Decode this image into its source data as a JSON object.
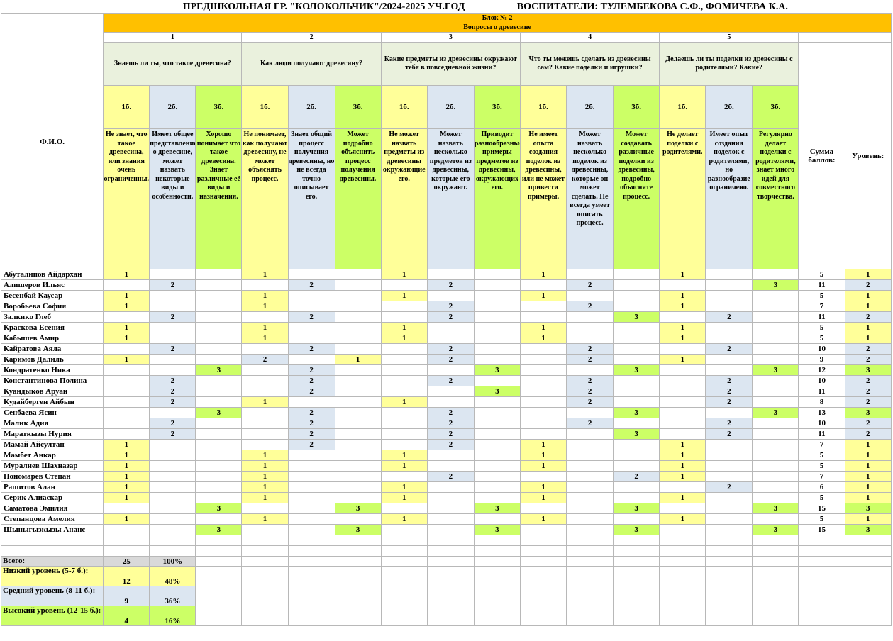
{
  "title_left": "ПРЕДШКОЛЬНАЯ ГР. \"КОЛОКОЛЬЧИК\"/2024-2025 УЧ.ГОД",
  "title_right": "ВОСПИТАТЕЛИ: ТУЛЕМБЕКОВА С.Ф., ФОМИЧЕВА К.А.",
  "block": "Блок № 2",
  "subject": "Вопросы о древесине",
  "fio_header": "Ф.И.О.",
  "sum_header": "Сумма баллов:",
  "level_header": "Уровень:",
  "questions": [
    {
      "num": "1",
      "text": "Знаешь ли ты, что такое древесина?",
      "points": [
        "1б.",
        "2б.",
        "3б."
      ],
      "desc": [
        "Не знает, что такое древесина, или знания очень ограниченны.",
        "Имеет общее представление о древесине, может назвать некоторые виды и особенности.",
        "Хорошо понимает что такое древесина. Знает различные её виды и назначения."
      ]
    },
    {
      "num": "2",
      "text": "Как люди получают древесину?",
      "points": [
        "1б.",
        "2б.",
        "3б."
      ],
      "desc": [
        "Не понимает, как получают древесину, не может объяснять процесс.",
        "Знает общий процесс получения древесины, но не всегда точно описывает его.",
        "Может подробно объяснить процесс получения древесины."
      ]
    },
    {
      "num": "3",
      "text": "Какие предметы из древесины окружают тебя в повседневной жизни?",
      "points": [
        "1б.",
        "2б.",
        "3б."
      ],
      "desc": [
        "Не может назвать предметы из древесины окружающие его.",
        "Может назвать несколько предметов из древесины, которые его окружают.",
        "Приводит разнообразные примеры предметов из древесины, окружающих его."
      ]
    },
    {
      "num": "4",
      "text": "Что ты можешь сделать из древесины сам? Какие поделки и игрушки?",
      "points": [
        "1б.",
        "2б.",
        "3б."
      ],
      "desc": [
        "Не имеет опыта создания поделок из древесины, или не может привести примеры.",
        "Может назвать несколько поделок из древесины, которые он может сделать. Не всегда умеет описать процесс.",
        "Может создавать различные поделки из древесины, подробно объясняте процесс."
      ]
    },
    {
      "num": "5",
      "text": "Делаешь ли ты поделки из древесины с родителями? Какие?",
      "points": [
        "1б.",
        "2б.",
        "3б."
      ],
      "desc": [
        "Не делает поделки с родителями.",
        "Имеет опыт создания поделок с родителями, но разнообразие ограничено.",
        "Регулярно делает поделки с родителями, знает много идей для совместного творчества."
      ]
    }
  ],
  "children": [
    {
      "name": "Абуталипов Айдархан",
      "s": [
        "1",
        "",
        "",
        "1",
        "",
        "",
        "1",
        "",
        "",
        "1",
        "",
        "",
        "1",
        "",
        ""
      ],
      "sum": "5",
      "level": "1"
    },
    {
      "name": "Алишеров Ильяс",
      "s": [
        "",
        "2",
        "",
        "",
        "2",
        "",
        "",
        "2",
        "",
        "",
        "2",
        "",
        "",
        "",
        "3"
      ],
      "sum": "11",
      "level": "2"
    },
    {
      "name": "Бесенбай Каусар",
      "s": [
        "1",
        "",
        "",
        "1",
        "",
        "",
        "1",
        "",
        "",
        "1",
        "",
        "",
        "1",
        "",
        ""
      ],
      "sum": "5",
      "level": "1"
    },
    {
      "name": "Воробьева София",
      "s": [
        "1",
        "",
        "",
        "1",
        "",
        "",
        "",
        "2",
        "",
        "",
        "2",
        "",
        "1",
        "",
        ""
      ],
      "sum": "7",
      "level": "1"
    },
    {
      "name": "Залкико Глеб",
      "s": [
        "",
        "2",
        "",
        "",
        "2",
        "",
        "",
        "2",
        "",
        "",
        "",
        "3",
        "",
        "2",
        ""
      ],
      "sum": "11",
      "level": "2"
    },
    {
      "name": "Краскова Есения",
      "s": [
        "1",
        "",
        "",
        "1",
        "",
        "",
        "1",
        "",
        "",
        "1",
        "",
        "",
        "1",
        "",
        ""
      ],
      "sum": "5",
      "level": "1"
    },
    {
      "name": "Кабышев Амир",
      "s": [
        "1",
        "",
        "",
        "1",
        "",
        "",
        "1",
        "",
        "",
        "1",
        "",
        "",
        "1",
        "",
        ""
      ],
      "sum": "5",
      "level": "1"
    },
    {
      "name": "Кайратова Аяла",
      "s": [
        "",
        "2",
        "",
        "",
        "2",
        "",
        "",
        "2",
        "",
        "",
        "2",
        "",
        "",
        "2",
        ""
      ],
      "sum": "10",
      "level": "2"
    },
    {
      "name": "Каримов Далиль",
      "s": [
        "1",
        "",
        "",
        "2",
        "",
        "1",
        "",
        "2",
        "",
        "",
        "2",
        "",
        "1",
        "",
        ""
      ],
      "sum": "9",
      "level": "2"
    },
    {
      "name": "Кондратенко Ника",
      "s": [
        "",
        "",
        "3",
        "",
        "2",
        "",
        "",
        "",
        "3",
        "",
        "",
        "3",
        "",
        "",
        "3"
      ],
      "sum": "12",
      "level": "3"
    },
    {
      "name": "Константинова Полина",
      "s": [
        "",
        "2",
        "",
        "",
        "2",
        "",
        "",
        "2",
        "",
        "",
        "2",
        "",
        "",
        "2",
        ""
      ],
      "sum": "10",
      "level": "2"
    },
    {
      "name": "Куандыков Аруан",
      "s": [
        "",
        "2",
        "",
        "",
        "2",
        "",
        "",
        "",
        "3",
        "",
        "2",
        "",
        "",
        "2",
        ""
      ],
      "sum": "11",
      "level": "2"
    },
    {
      "name": "Кудайберген Айбын",
      "s": [
        "",
        "2",
        "",
        "1",
        "",
        "",
        "1",
        "",
        "",
        "",
        "2",
        "",
        "",
        "2",
        ""
      ],
      "sum": "8",
      "level": "2"
    },
    {
      "name": "Сенбаева Ясин",
      "s": [
        "",
        "",
        "3",
        "",
        "2",
        "",
        "",
        "2",
        "",
        "",
        "",
        "3",
        "",
        "",
        "3"
      ],
      "sum": "13",
      "level": "3"
    },
    {
      "name": "Малик Адия",
      "s": [
        "",
        "2",
        "",
        "",
        "2",
        "",
        "",
        "2",
        "",
        "",
        "2",
        "",
        "",
        "2",
        ""
      ],
      "sum": "10",
      "level": "2"
    },
    {
      "name": "Мараткызы Нурия",
      "s": [
        "",
        "2",
        "",
        "",
        "2",
        "",
        "",
        "2",
        "",
        "",
        "",
        "3",
        "",
        "2",
        ""
      ],
      "sum": "11",
      "level": "2"
    },
    {
      "name": "Мамай Айсултан",
      "s": [
        "1",
        "",
        "",
        "",
        "2",
        "",
        "",
        "2",
        "",
        "1",
        "",
        "",
        "1",
        "",
        ""
      ],
      "sum": "7",
      "level": "1"
    },
    {
      "name": "Мамбет Анкар",
      "s": [
        "1",
        "",
        "",
        "1",
        "",
        "",
        "1",
        "",
        "",
        "1",
        "",
        "",
        "1",
        "",
        ""
      ],
      "sum": "5",
      "level": "1"
    },
    {
      "name": "Муралиев Шахназар",
      "s": [
        "1",
        "",
        "",
        "1",
        "",
        "",
        "1",
        "",
        "",
        "1",
        "",
        "",
        "1",
        "",
        ""
      ],
      "sum": "5",
      "level": "1"
    },
    {
      "name": "Пономарев Степан",
      "s": [
        "1",
        "",
        "",
        "1",
        "",
        "",
        "",
        "2",
        "",
        "",
        "",
        "2",
        "1",
        "",
        ""
      ],
      "sum": "7",
      "level": "1"
    },
    {
      "name": "Рашитов Алан",
      "s": [
        "1",
        "",
        "",
        "1",
        "",
        "",
        "1",
        "",
        "",
        "1",
        "",
        "",
        "",
        "2",
        ""
      ],
      "sum": "6",
      "level": "1"
    },
    {
      "name": "Серик Алиаскар",
      "s": [
        "1",
        "",
        "",
        "1",
        "",
        "",
        "1",
        "",
        "",
        "1",
        "",
        "",
        "1",
        "",
        ""
      ],
      "sum": "5",
      "level": "1"
    },
    {
      "name": "Саматова Эмилия",
      "s": [
        "",
        "",
        "3",
        "",
        "",
        "3",
        "",
        "",
        "3",
        "",
        "",
        "3",
        "",
        "",
        "3"
      ],
      "sum": "15",
      "level": "3"
    },
    {
      "name": "Степанцова Амелия",
      "s": [
        "1",
        "",
        "",
        "1",
        "",
        "",
        "1",
        "",
        "",
        "1",
        "",
        "",
        "1",
        "",
        ""
      ],
      "sum": "5",
      "level": "1"
    },
    {
      "name": "Шыныгызкызы Ананс",
      "s": [
        "",
        "",
        "3",
        "",
        "",
        "3",
        "",
        "",
        "3",
        "",
        "",
        "3",
        "",
        "",
        "3"
      ],
      "sum": "15",
      "level": "3"
    }
  ],
  "summary": {
    "total_label": "Всего:",
    "total_count": "25",
    "total_pct": "100%",
    "low_label": "Низкий уровень (5-7 б.):",
    "low_count": "12",
    "low_pct": "48%",
    "mid_label": "Средний уровень (8-11 б.):",
    "mid_count": "9",
    "mid_pct": "36%",
    "high_label": "Высокий уровень (12-15 б.):",
    "high_count": "4",
    "high_pct": "16%"
  },
  "colors": {
    "yellow": "#ffff99",
    "blue": "#dce6f1",
    "green": "#ccff66",
    "orange": "#ffc000",
    "question_bg": "#eaf1dd"
  }
}
